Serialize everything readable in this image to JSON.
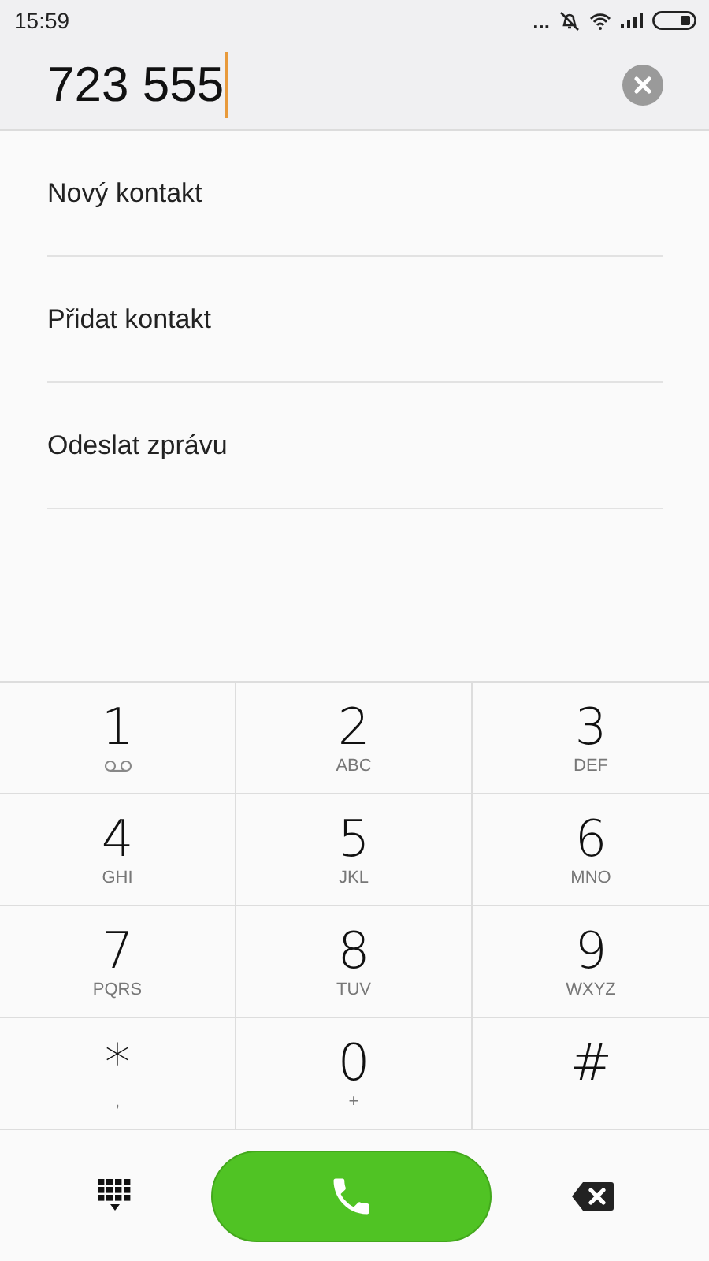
{
  "status_bar": {
    "time": "15:59",
    "more": "..."
  },
  "dial_field": {
    "value": "723 555"
  },
  "actions": [
    {
      "label": "Nový kontakt"
    },
    {
      "label": "Přidat kontakt"
    },
    {
      "label": "Odeslat zprávu"
    }
  ],
  "keypad": [
    {
      "digit": "1",
      "kind": "voicemail"
    },
    {
      "digit": "2",
      "kind": "letters",
      "letters": "ABC"
    },
    {
      "digit": "3",
      "kind": "letters",
      "letters": "DEF"
    },
    {
      "digit": "4",
      "kind": "letters",
      "letters": "GHI"
    },
    {
      "digit": "5",
      "kind": "letters",
      "letters": "JKL"
    },
    {
      "digit": "6",
      "kind": "letters",
      "letters": "MNO"
    },
    {
      "digit": "7",
      "kind": "letters",
      "letters": "PQRS"
    },
    {
      "digit": "8",
      "kind": "letters",
      "letters": "TUV"
    },
    {
      "digit": "9",
      "kind": "letters",
      "letters": "WXYZ"
    },
    {
      "digit": "*",
      "kind": "letters",
      "letters": ","
    },
    {
      "digit": "0",
      "kind": "letters",
      "letters": "+"
    },
    {
      "digit": "#",
      "kind": "plain"
    }
  ]
}
